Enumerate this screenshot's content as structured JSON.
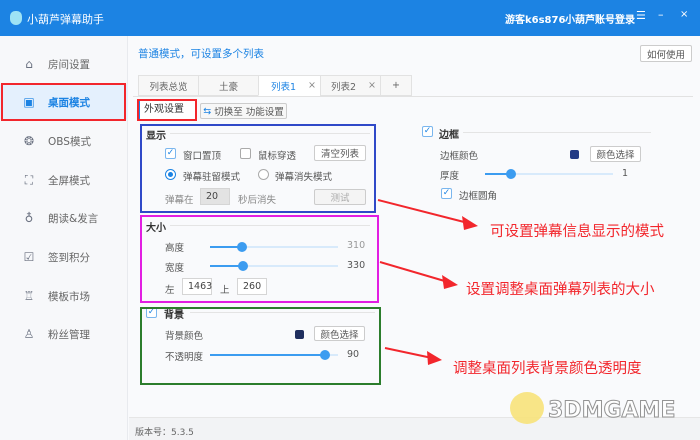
{
  "titlebar": {
    "app_title": "小葫芦弹幕助手",
    "user": "游客k6s876",
    "login": "小葫芦账号登录",
    "menu_icon": "hamburger-icon",
    "minimize_icon": "minimize-icon",
    "close_icon": "close-icon",
    "color": "#1c83e3"
  },
  "sidebar": {
    "items": [
      {
        "label": "房间设置",
        "icon": "home-icon"
      },
      {
        "label": "桌面模式",
        "icon": "monitor-icon",
        "active": true
      },
      {
        "label": "OBS模式",
        "icon": "obs-icon"
      },
      {
        "label": "全屏模式",
        "icon": "fullscreen-icon"
      },
      {
        "label": "朗读&发言",
        "icon": "microphone-icon"
      },
      {
        "label": "签到积分",
        "icon": "calendar-check-icon"
      },
      {
        "label": "模板市场",
        "icon": "shirt-icon"
      },
      {
        "label": "粉丝管理",
        "icon": "fans-icon"
      }
    ]
  },
  "main": {
    "subtitle": "普通模式，可设置多个列表",
    "help_button": "如何使用",
    "tabs": [
      {
        "label": "列表总览"
      },
      {
        "label": "土豪"
      },
      {
        "label": "列表1",
        "active": true,
        "close": "×"
      },
      {
        "label": "列表2",
        "close": "×"
      },
      {
        "label": "+"
      }
    ],
    "section_tab": "外观设置",
    "switch_button": "切换至 功能设置",
    "display": {
      "title": "显示",
      "window_top": "窗口置顶",
      "window_top_checked": true,
      "mouse_through": "鼠标穿透",
      "mouse_through_checked": false,
      "clear_button": "清空列表",
      "mode_stay": "弹幕驻留模式",
      "mode_vanish": "弹幕消失模式",
      "selected_mode": "弹幕驻留模式",
      "vanish_prefix": "弹幕在",
      "vanish_seconds": "20",
      "vanish_suffix": "秒后消失",
      "test_button": "测试"
    },
    "size": {
      "title": "大小",
      "height_label": "高度",
      "height_value": "310",
      "height_fraction": 0.25,
      "width_label": "宽度",
      "width_value": "330",
      "width_fraction": 0.26,
      "left_label": "左",
      "left_value": "1463",
      "top_label": "上",
      "top_value": "260"
    },
    "background": {
      "title": "背景",
      "checked": true,
      "color_label": "背景颜色",
      "color": "#1f2e5e",
      "color_button": "颜色选择",
      "opacity_label": "不透明度",
      "opacity_value": "90",
      "opacity_fraction": 0.9
    },
    "border": {
      "title": "边框",
      "checked": true,
      "color_label": "边框颜色",
      "color": "#233b85",
      "color_button": "颜色选择",
      "thickness_label": "厚度",
      "thickness_value": "1",
      "thickness_fraction": 0.2,
      "rounded_label": "边框圆角",
      "rounded_checked": true
    },
    "version": "版本号：5.3.5"
  },
  "annotations": [
    "可设置弹幕信息显示的模式",
    "设置调整桌面弹幕列表的大小",
    "调整桌面列表背景颜色透明度"
  ],
  "watermark": "3DMGAME",
  "colors": {
    "highlight_red": "#f2262c",
    "display_box": "#2f49c8",
    "size_box": "#e21ee2",
    "background_box": "#2c7d2c"
  }
}
